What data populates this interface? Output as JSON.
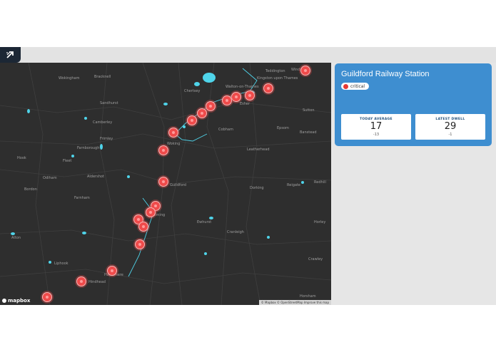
{
  "header": {
    "logo_icon": "arrow-out-icon"
  },
  "map": {
    "brand": "mapbox",
    "attribution": "© Mapbox © OpenStreetMap Improve this map",
    "place_labels": [
      "Teddington",
      "Kingston upon Thames",
      "Sutton",
      "Epsom",
      "Banstead",
      "Leatherhead",
      "Dorking",
      "Reigate",
      "Redhill",
      "Horley",
      "Crawley",
      "Guildford",
      "Woking",
      "Chertsey",
      "Walton-on-Thames",
      "Esher",
      "Cobham",
      "Wokingham",
      "Bracknell",
      "Sandhurst",
      "Camberley",
      "Frimley",
      "Farnborough",
      "Aldershot",
      "Farnham",
      "Godalming",
      "Haslemere",
      "Fleet",
      "Hook",
      "Odiham",
      "Alton",
      "Cranleigh",
      "Horsham",
      "Bordon",
      "Liphook",
      "Hindhead",
      "Ewhurst",
      "Windsor"
    ],
    "marker_status": "critical"
  },
  "station": {
    "title": "Guildford Railway Station",
    "status": "critical",
    "status_color": "#e53935",
    "accent": "#3e8ed0",
    "today_average": {
      "label": "TODAY AVERAGE",
      "value": "17",
      "delta": "-13"
    },
    "latest_dwell": {
      "label": "LATEST DWELL",
      "value": "29",
      "delta": "-1"
    }
  }
}
